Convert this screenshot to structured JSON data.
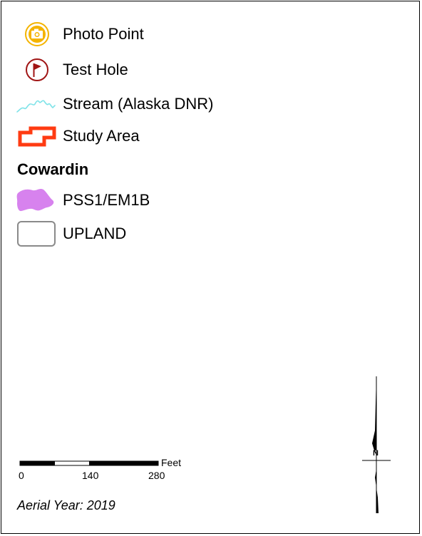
{
  "legend": {
    "items": [
      {
        "label": "Photo Point",
        "icon": "camera-icon",
        "color": "#f4b400"
      },
      {
        "label": "Test Hole",
        "icon": "flag-icon",
        "color": "#a01515"
      },
      {
        "label": "Stream (Alaska DNR)",
        "icon": "stream-line-icon",
        "color": "#7fe3e8"
      },
      {
        "label": "Study Area",
        "icon": "study-area-outline-icon",
        "color": "#ff3b12"
      }
    ],
    "heading": "Cowardin",
    "cowardin_items": [
      {
        "label": "PSS1/EM1B",
        "icon": "wetland-polygon-icon",
        "color": "#d782ee"
      },
      {
        "label": "UPLAND",
        "icon": "upland-box-icon",
        "color": "#8a8a8a"
      }
    ]
  },
  "scalebar": {
    "units": "Feet",
    "ticks": [
      "0",
      "140",
      "280"
    ]
  },
  "aerial_year_text": "Aerial Year: 2019",
  "north_arrow": {
    "label": "N",
    "icon": "north-arrow-icon"
  }
}
